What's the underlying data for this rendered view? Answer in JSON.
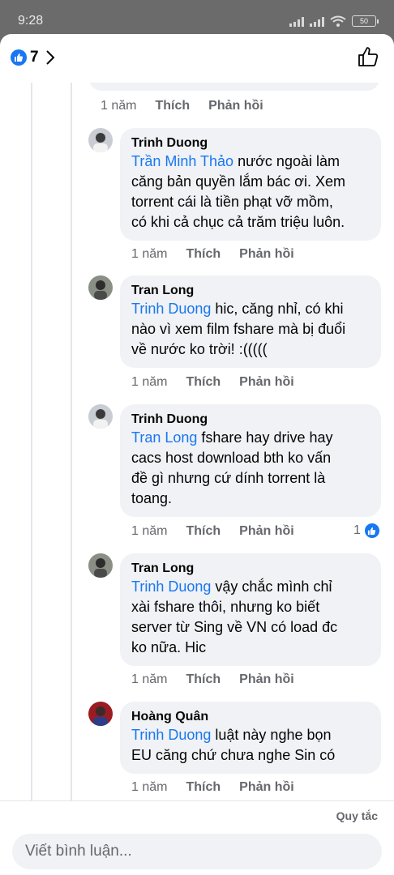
{
  "status": {
    "time": "9:28",
    "battery": "50"
  },
  "header": {
    "like_count": "7"
  },
  "top_actions": {
    "time": "1 năm",
    "like": "Thích",
    "reply": "Phản hồi"
  },
  "comments": [
    {
      "author": "Trinh Duong",
      "mention": "Trần Minh Thảo",
      "lines": [
        " nước ngoài làm",
        "căng bản quyền lắm bác ơi. Xem",
        "torrent cái là tiền phạt vỡ mồm,",
        "có khi cả chục cả trăm triệu luôn."
      ],
      "time": "1 năm",
      "like": "Thích",
      "reply": "Phản hồi"
    },
    {
      "author": "Tran Long",
      "mention": "Trinh Duong",
      "lines": [
        " hic, căng nhỉ, có khi",
        "nào vì xem film fshare mà bị đuổi",
        "về nước ko trời! :((((("
      ],
      "time": "1 năm",
      "like": "Thích",
      "reply": "Phản hồi"
    },
    {
      "author": "Trinh Duong",
      "mention": "Tran Long",
      "lines": [
        " fshare hay drive hay",
        "cacs host download bth ko vấn",
        "đề gì nhưng cứ dính torrent là",
        "toang."
      ],
      "time": "1 năm",
      "like": "Thích",
      "reply": "Phản hồi",
      "reactions": "1"
    },
    {
      "author": "Tran Long",
      "mention": "Trinh Duong",
      "lines": [
        " vậy chắc mình chỉ",
        "xài fshare thôi, nhưng ko biết",
        "server từ Sing về VN có load đc",
        "ko nữa. Hic"
      ],
      "time": "1 năm",
      "like": "Thích",
      "reply": "Phản hồi"
    },
    {
      "author": "Hoàng Quân",
      "mention": "Trinh Duong",
      "lines": [
        " luật này nghe bọn",
        "EU căng chứ chưa nghe Sin có"
      ],
      "time": "1 năm",
      "like": "Thích",
      "reply": "Phản hồi"
    }
  ],
  "footer": {
    "rules": "Quy tắc",
    "input_placeholder": "Viết bình luận..."
  }
}
